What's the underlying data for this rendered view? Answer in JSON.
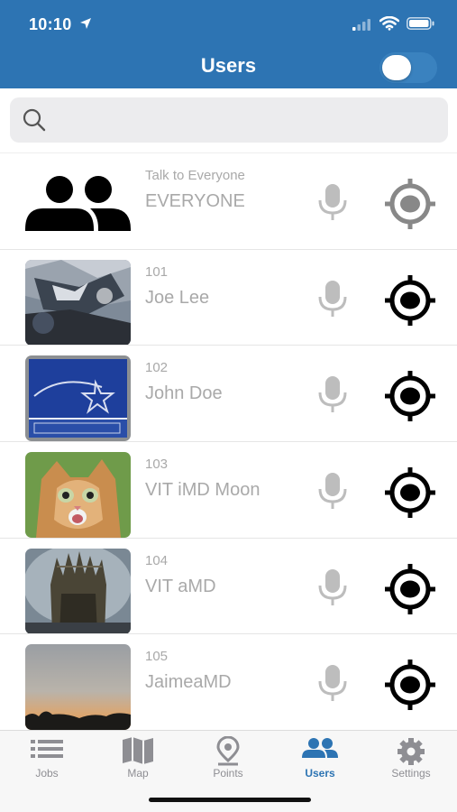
{
  "status_bar": {
    "time": "10:10"
  },
  "header": {
    "title": "Users",
    "toggle_on": false
  },
  "search": {
    "placeholder": "",
    "value": ""
  },
  "users": [
    {
      "ext": "Talk to Everyone",
      "name": "EVERYONE",
      "avatar": "group-icon"
    },
    {
      "ext": "101",
      "name": "Joe Lee",
      "avatar": "avatar-photo"
    },
    {
      "ext": "102",
      "name": "John Doe",
      "avatar": "energy-star-photo"
    },
    {
      "ext": "103",
      "name": "VIT iMD Moon",
      "avatar": "cat-photo"
    },
    {
      "ext": "104",
      "name": "VIT aMD",
      "avatar": "throne-photo"
    },
    {
      "ext": "105",
      "name": "JaimeaMD",
      "avatar": "sunset-photo"
    }
  ],
  "tabs": [
    {
      "label": "Jobs",
      "icon": "list-icon"
    },
    {
      "label": "Map",
      "icon": "map-icon"
    },
    {
      "label": "Points",
      "icon": "map-pin-icon"
    },
    {
      "label": "Users",
      "icon": "users-icon",
      "active": true
    },
    {
      "label": "Settings",
      "icon": "gear-icon"
    }
  ],
  "colors": {
    "header": "#2d74b3",
    "active_tab": "#2d74b3",
    "muted_text": "#a9a9a9"
  }
}
